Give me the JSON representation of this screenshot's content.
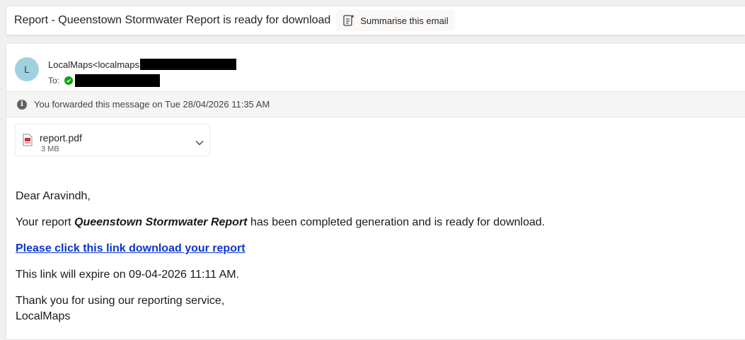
{
  "subject": {
    "title": "Report - Queenstown Stormwater Report is ready for download",
    "summarise_label": "Summarise this email",
    "summarise_icon": "summarise-icon"
  },
  "sender": {
    "avatar_initial": "L",
    "avatar_color": "#9fd2de",
    "from_text": "LocalMaps<localmaps",
    "to_label": "To:",
    "presence_color": "#13a10e"
  },
  "forward_notice": {
    "icon": "info-icon",
    "text": "You forwarded this message on Tue 28/04/2026 11:35 AM"
  },
  "attachment": {
    "icon": "pdf-file-icon",
    "name": "report.pdf",
    "size": "3 MB",
    "expand_icon": "chevron-down-icon"
  },
  "body": {
    "greeting": "Dear Aravindh,",
    "line1_prefix": "Your report ",
    "report_name": "Queenstown Stormwater Report",
    "line1_suffix": " has been completed generation and is ready for download.",
    "link_text": "Please click this link download your report",
    "expiry": "This link will expire on 09-04-2026 11:11 AM.",
    "thanks": "Thank you for using our reporting service,",
    "signature": "LocalMaps"
  },
  "colors": {
    "link": "#0b36c8",
    "page_bg": "#f0f0f0"
  }
}
